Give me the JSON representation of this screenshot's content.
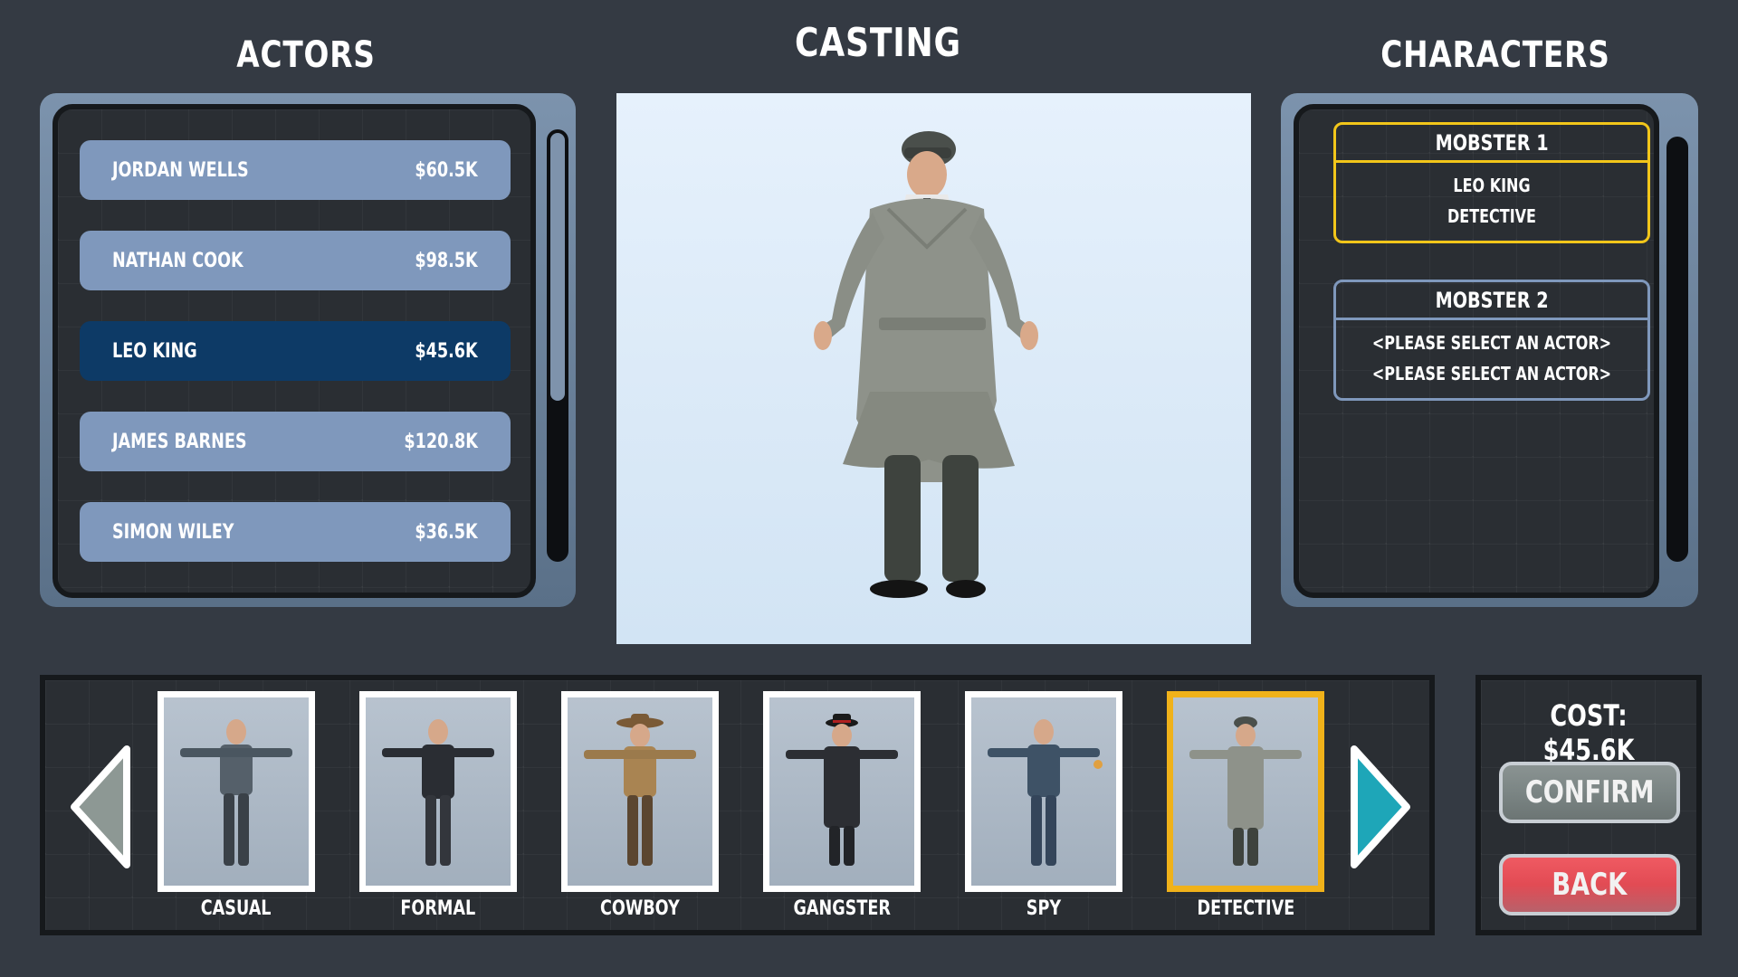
{
  "headings": {
    "actors": "ACTORS",
    "casting": "CASTING",
    "characters": "CHARACTERS"
  },
  "actors": [
    {
      "name": "JORDAN WELLS",
      "price": "$60.5K",
      "selected": false
    },
    {
      "name": "NATHAN COOK",
      "price": "$98.5K",
      "selected": false
    },
    {
      "name": "LEO KING",
      "price": "$45.6K",
      "selected": true
    },
    {
      "name": "JAMES BARNES",
      "price": "$120.8K",
      "selected": false
    },
    {
      "name": "SIMON WILEY",
      "price": "$36.5K",
      "selected": false
    }
  ],
  "characters": [
    {
      "title": "MOBSTER 1",
      "actor": "LEO KING",
      "outfit": "DETECTIVE",
      "active": true
    },
    {
      "title": "MOBSTER 2",
      "actor": "<PLEASE SELECT AN ACTOR>",
      "outfit": "<PLEASE SELECT AN ACTOR>",
      "active": false
    }
  ],
  "outfits": [
    {
      "label": "CASUAL",
      "selected": false
    },
    {
      "label": "FORMAL",
      "selected": false
    },
    {
      "label": "COWBOY",
      "selected": false
    },
    {
      "label": "GANGSTER",
      "selected": false
    },
    {
      "label": "SPY",
      "selected": false
    },
    {
      "label": "DETECTIVE",
      "selected": true
    }
  ],
  "cost": {
    "text": "COST: $45.6K"
  },
  "buttons": {
    "confirm": "CONFIRM",
    "back": "BACK"
  },
  "icons": {
    "left_arrow": "arrow-left-icon",
    "right_arrow": "arrow-right-icon"
  },
  "colors": {
    "background": "#343a43",
    "actor_row": "#7f98bc",
    "actor_row_selected": "#0d3a66",
    "highlight": "#f2c61a",
    "arrow_right": "#1ea6b8",
    "arrow_left": "#8d9894",
    "back_button": "#e24b54"
  }
}
